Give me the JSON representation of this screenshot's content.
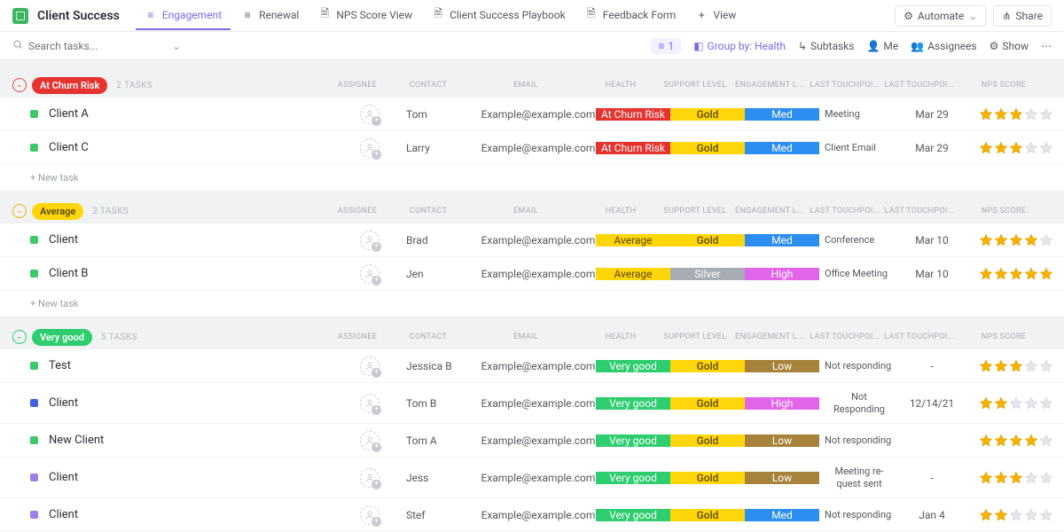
{
  "header": {
    "title": "Client Success",
    "tabs": [
      {
        "label": "Engagement",
        "active": true,
        "icon": "list"
      },
      {
        "label": "Renewal",
        "icon": "list"
      },
      {
        "label": "NPS Score View",
        "icon": "doc"
      },
      {
        "label": "Client Success Playbook",
        "icon": "doc"
      },
      {
        "label": "Feedback Form",
        "icon": "doc"
      },
      {
        "label": "View",
        "icon": "plus"
      }
    ],
    "automate": "Automate",
    "share": "Share"
  },
  "toolbar": {
    "search_placeholder": "Search tasks...",
    "filter_count": "1",
    "groupby_label": "Group by: Health",
    "subtasks": "Subtasks",
    "me": "Me",
    "assignees": "Assignees",
    "show": "Show"
  },
  "columns": [
    "ASSIGNEE",
    "CONTACT",
    "EMAIL",
    "HEALTH",
    "SUPPORT LEVEL",
    "ENGAGEMENT L...",
    "LAST TOUCHPOI...",
    "LAST TOUCHPOI...",
    "NPS SCORE"
  ],
  "groups": [
    {
      "name": "At Churn Risk",
      "badge": "red",
      "collapse": "red",
      "count": "2 TASKS",
      "new_task": "+ New task",
      "rows": [
        {
          "sq": "green",
          "name": "Client A",
          "contact": "Tom",
          "email": "Example@example.com",
          "health": {
            "t": "At Churn Risk",
            "c": "red"
          },
          "support": {
            "t": "Gold",
            "c": "gold"
          },
          "engage": {
            "t": "Med",
            "c": "blue"
          },
          "touch1": "Meeting",
          "touch2": "Mar 29",
          "stars": 3
        },
        {
          "sq": "green",
          "name": "Client C",
          "contact": "Larry",
          "email": "Example@example.com",
          "health": {
            "t": "At Churn Risk",
            "c": "red"
          },
          "support": {
            "t": "Gold",
            "c": "gold"
          },
          "engage": {
            "t": "Med",
            "c": "blue"
          },
          "touch1": "Client Email",
          "touch2": "Mar 29",
          "stars": 3
        }
      ]
    },
    {
      "name": "Average",
      "badge": "yellow",
      "collapse": "yellow",
      "count": "2 TASKS",
      "new_task": "+ New task",
      "rows": [
        {
          "sq": "green",
          "name": "Client",
          "contact": "Brad",
          "email": "Example@example.com",
          "health": {
            "t": "Average",
            "c": "yellow"
          },
          "support": {
            "t": "Gold",
            "c": "gold"
          },
          "engage": {
            "t": "Med",
            "c": "blue"
          },
          "touch1": "Conference",
          "touch2": "Mar 10",
          "stars": 4
        },
        {
          "sq": "green",
          "name": "Client B",
          "contact": "Jen",
          "email": "Example@example.com",
          "health": {
            "t": "Average",
            "c": "yellow"
          },
          "support": {
            "t": "Silver",
            "c": "silver"
          },
          "engage": {
            "t": "High",
            "c": "pink"
          },
          "touch1": "Office Meeting",
          "touch2": "Mar 10",
          "stars": 5
        }
      ]
    },
    {
      "name": "Very good",
      "badge": "green",
      "collapse": "green",
      "count": "5 TASKS",
      "rows": [
        {
          "sq": "green",
          "name": "Test",
          "contact": "Jessica B",
          "email": "Example@example.com",
          "health": {
            "t": "Very good",
            "c": "green"
          },
          "support": {
            "t": "Gold",
            "c": "gold"
          },
          "engage": {
            "t": "Low",
            "c": "brown"
          },
          "touch1": "Not responding",
          "touch2": "-",
          "stars": 3
        },
        {
          "sq": "blue",
          "name": "Client",
          "contact": "Tom B",
          "email": "Example@example.com",
          "health": {
            "t": "Very good",
            "c": "green"
          },
          "support": {
            "t": "Gold",
            "c": "gold"
          },
          "engage": {
            "t": "High",
            "c": "pink"
          },
          "touch1": "Not Responding",
          "touch2": "12/14/21",
          "stars": 2,
          "tall": true
        },
        {
          "sq": "green",
          "name": "New Client",
          "contact": "Tom A",
          "email": "Example@example.com",
          "health": {
            "t": "Very good",
            "c": "green"
          },
          "support": {
            "t": "Gold",
            "c": "gold"
          },
          "engage": {
            "t": "Low",
            "c": "brown"
          },
          "touch1": "Not responding",
          "touch2": "",
          "stars": 4
        },
        {
          "sq": "purple",
          "name": "Client",
          "contact": "Jess",
          "email": "Example@example.com",
          "health": {
            "t": "Very good",
            "c": "green"
          },
          "support": {
            "t": "Gold",
            "c": "gold"
          },
          "engage": {
            "t": "Low",
            "c": "brown"
          },
          "touch1": "Meeting re-quest sent",
          "touch2": "-",
          "stars": 3,
          "tall": true
        },
        {
          "sq": "purple",
          "name": "Client",
          "contact": "Stef",
          "email": "Example@example.com",
          "health": {
            "t": "Very good",
            "c": "green"
          },
          "support": {
            "t": "Gold",
            "c": "gold"
          },
          "engage": {
            "t": "Med",
            "c": "blue"
          },
          "touch1": "Not responding",
          "touch2": "Jan 4",
          "stars": 2
        }
      ]
    }
  ]
}
